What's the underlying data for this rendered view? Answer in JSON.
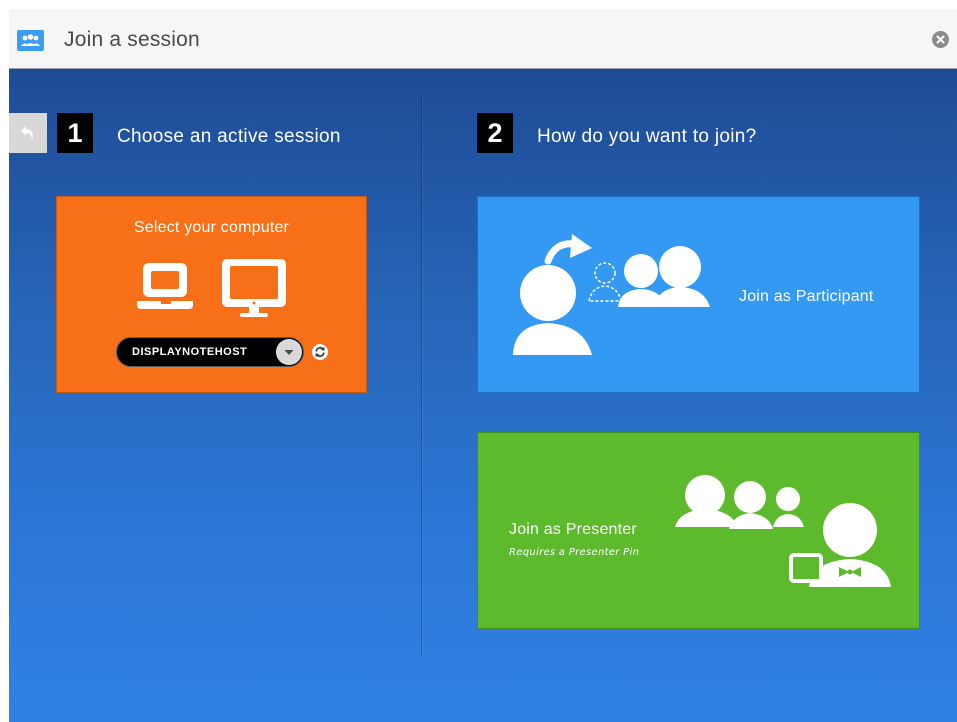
{
  "window": {
    "title": "Join a session",
    "app_icon": "group-icon",
    "close_icon": "close-icon"
  },
  "step1": {
    "number": "1",
    "title": "Choose an active session",
    "back_icon": "back-arrow-icon",
    "card": {
      "label": "Select your computer",
      "icons": [
        "laptop-icon",
        "desktop-monitor-icon"
      ],
      "host_select": {
        "value": "DISPLAYNOTEHOST"
      },
      "refresh_icon": "refresh-icon"
    }
  },
  "step2": {
    "number": "2",
    "title": "How do you want to join?",
    "participant": {
      "label": "Join as Participant"
    },
    "presenter": {
      "label": "Join as Presenter",
      "sublabel": "Requires a Presenter Pin"
    }
  },
  "colors": {
    "title_bar": "#f6f6f7",
    "background_top": "#1e4b96",
    "background_bottom": "#2f82e4",
    "orange_card": "#f77017",
    "blue_card": "#3399f2",
    "green_card": "#5cba2c"
  }
}
